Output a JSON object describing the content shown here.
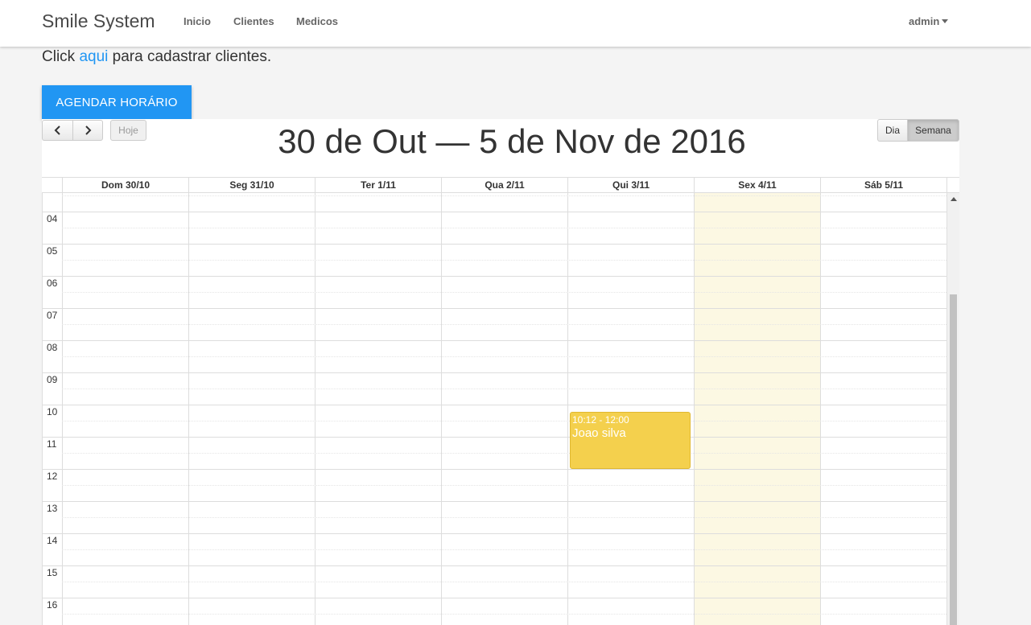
{
  "navbar": {
    "brand": "Smile System",
    "links": [
      "Inicio",
      "Clientes",
      "Medicos"
    ],
    "user": "admin"
  },
  "notice": {
    "prefix": "Click ",
    "link": "aqui",
    "suffix": " para cadastrar clientes."
  },
  "agendar_button": "AGENDAR HORÁRIO",
  "calendar": {
    "title": "30 de Out — 5 de Nov de 2016",
    "today_button": "Hoje",
    "views": [
      "Dia",
      "Semana"
    ],
    "active_view": "Semana",
    "days": [
      "Dom 30/10",
      "Seg 31/10",
      "Ter 1/11",
      "Qua 2/11",
      "Qui 3/11",
      "Sex 4/11",
      "Sáb 5/11"
    ],
    "today_index": 5,
    "hours": [
      "04",
      "05",
      "06",
      "07",
      "08",
      "09",
      "10",
      "11",
      "12",
      "13",
      "14",
      "15",
      "16"
    ],
    "events": [
      {
        "day_index": 4,
        "time": "10:12 - 12:00",
        "title": "Joao silva",
        "color": "#f4d04d"
      }
    ]
  },
  "colors": {
    "primary": "#2196f3",
    "today_bg": "#fcf8e3",
    "event": "#f4d04d"
  }
}
